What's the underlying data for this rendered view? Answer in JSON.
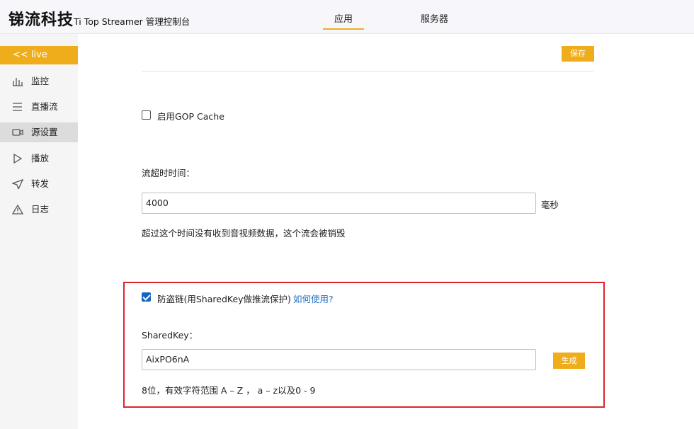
{
  "header": {
    "brand": "锑流科技",
    "subtitle": "Ti Top Streamer 管理控制台",
    "tabs": [
      {
        "label": "应用",
        "active": true
      },
      {
        "label": "服务器",
        "active": false
      }
    ],
    "accent_color": "#f0ad1b"
  },
  "sidebar": {
    "back_label": "<< live",
    "items": [
      {
        "label": "监控",
        "icon": "bar-chart-icon"
      },
      {
        "label": "直播流",
        "icon": "list-icon"
      },
      {
        "label": "源设置",
        "icon": "video-camera-icon",
        "active": true
      },
      {
        "label": "播放",
        "icon": "play-icon"
      },
      {
        "label": "转发",
        "icon": "send-icon"
      },
      {
        "label": "日志",
        "icon": "warning-icon"
      }
    ]
  },
  "main": {
    "save_label": "保存",
    "gop_cache": {
      "label": "启用GOP Cache",
      "checked": false
    },
    "timeout": {
      "label": "流超时时间：",
      "value": "4000",
      "unit": "毫秒",
      "hint": "超过这个时间没有收到音视频数据，这个流会被销毁"
    },
    "shared_key": {
      "checkbox_label": "防盗链(用SharedKey做推流保护)",
      "checked": true,
      "help_link": "如何使用?",
      "label": "SharedKey：",
      "value": "AixPO6nA",
      "generate_label": "生成",
      "hint": "8位，有效字符范围 A – Z ， a – z以及0 - 9"
    }
  }
}
